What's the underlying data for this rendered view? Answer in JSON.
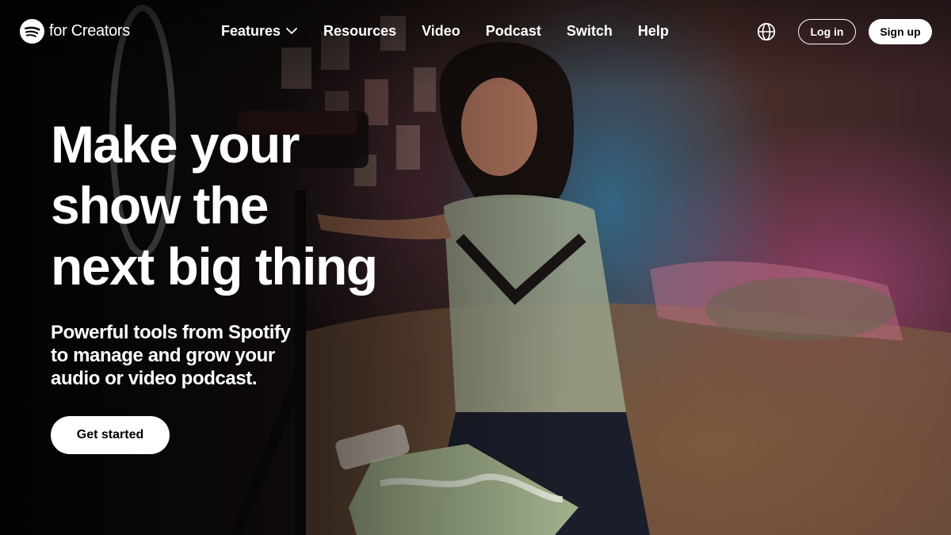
{
  "brand": {
    "logo_text": "for Creators",
    "logo_icon": "spotify-logo-icon"
  },
  "nav": {
    "items": [
      {
        "label": "Features",
        "has_dropdown": true
      },
      {
        "label": "Resources"
      },
      {
        "label": "Video"
      },
      {
        "label": "Podcast"
      },
      {
        "label": "Switch"
      },
      {
        "label": "Help"
      }
    ],
    "language_icon": "globe-icon",
    "login_label": "Log in",
    "signup_label": "Sign up"
  },
  "hero": {
    "headline_lines": [
      "Make your",
      "show the",
      "next big thing"
    ],
    "subheadline_lines": [
      "Powerful tools from Spotify",
      "to manage and grow your",
      "audio or video podcast."
    ],
    "cta_label": "Get started"
  },
  "colors": {
    "text": "#ffffff",
    "button_bg": "#ffffff",
    "button_text": "#000000"
  }
}
